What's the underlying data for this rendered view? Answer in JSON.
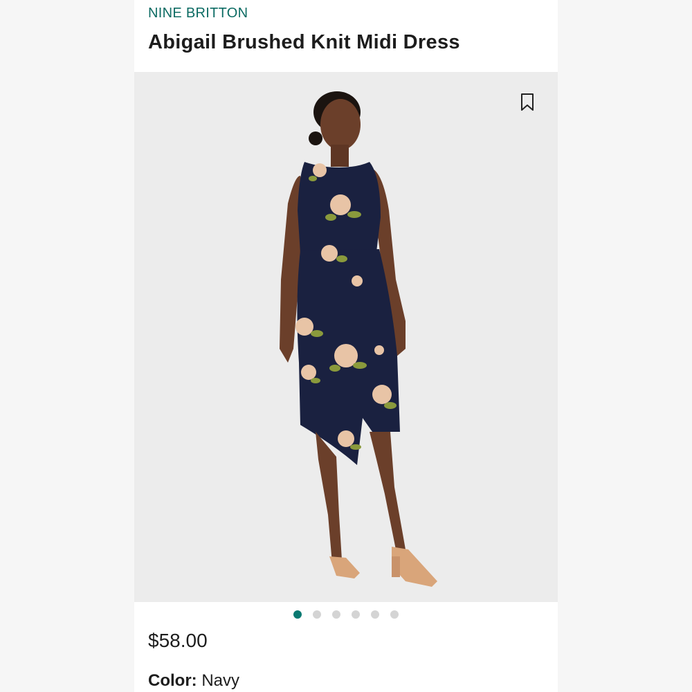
{
  "product": {
    "brand": "NINE BRITTON",
    "title": "Abigail Brushed Knit Midi Dress",
    "price": "$58.00",
    "color_label": "Color:",
    "color_value": "Navy"
  },
  "gallery": {
    "image_count": 6,
    "active_index": 0,
    "bookmark_icon": "bookmark-icon"
  },
  "colors": {
    "brand_teal": "#0b6b63",
    "dot_active": "#0b7a72",
    "dot_inactive": "#d4d4d4",
    "image_bg": "#ececec",
    "dress_navy": "#1a2140"
  }
}
